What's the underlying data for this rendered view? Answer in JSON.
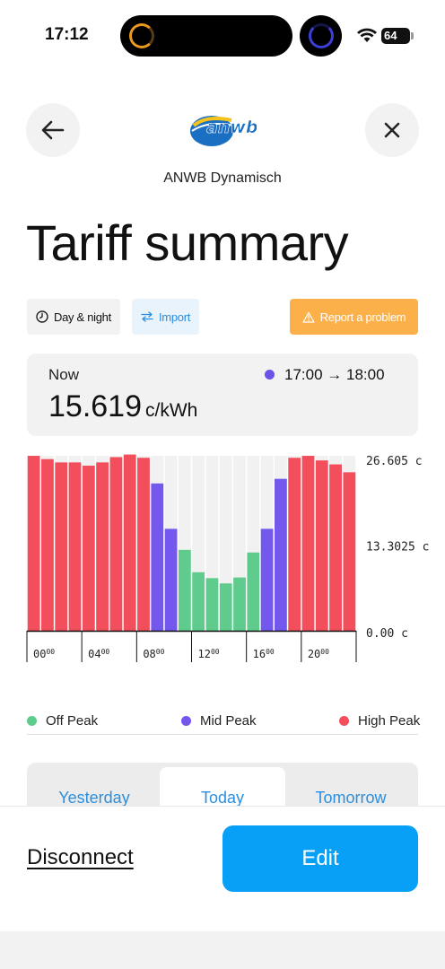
{
  "status_bar": {
    "time": "17:12",
    "battery": "64"
  },
  "header": {
    "provider_name": "ANWB Dynamisch",
    "logo_text": "anwb"
  },
  "page_title": "Tariff summary",
  "chips": {
    "day_night": "Day & night",
    "import": "Import",
    "report": "Report a problem"
  },
  "now": {
    "label": "Now",
    "value": "15.619",
    "unit": "c/kWh",
    "range": "17:00 → 18:00",
    "dot_color": "#6b52e8"
  },
  "colors": {
    "off_peak": "#5fcb8c",
    "mid_peak": "#7458ee",
    "high_peak": "#f24e5c",
    "accent": "#08a0f7",
    "report": "#fbb04a"
  },
  "chart_data": {
    "type": "bar",
    "categories": [
      "00",
      "01",
      "02",
      "03",
      "04",
      "05",
      "06",
      "07",
      "08",
      "09",
      "10",
      "11",
      "12",
      "13",
      "14",
      "15",
      "16",
      "17",
      "18",
      "19",
      "20",
      "21",
      "22",
      "23"
    ],
    "values": [
      26.6,
      26.1,
      25.6,
      25.6,
      25.1,
      25.6,
      26.4,
      26.8,
      26.3,
      22.4,
      15.5,
      12.3,
      8.9,
      8.0,
      7.2,
      8.1,
      11.9,
      15.5,
      23.1,
      26.3,
      26.6,
      25.9,
      25.3,
      24.1
    ],
    "levels": [
      "high",
      "high",
      "high",
      "high",
      "high",
      "high",
      "high",
      "high",
      "high",
      "mid",
      "mid",
      "off",
      "off",
      "off",
      "off",
      "off",
      "off",
      "mid",
      "mid",
      "high",
      "high",
      "high",
      "high",
      "high"
    ],
    "ylim": [
      0,
      26.605
    ],
    "ytick_labels": [
      "26.605 c",
      "13.3025 c",
      "0.00 c"
    ],
    "xtick_labels": [
      {
        "hour": "00",
        "minutes": "00"
      },
      {
        "hour": "04",
        "minutes": "00"
      },
      {
        "hour": "08",
        "minutes": "00"
      },
      {
        "hour": "12",
        "minutes": "00"
      },
      {
        "hour": "16",
        "minutes": "00"
      },
      {
        "hour": "20",
        "minutes": "00"
      }
    ],
    "legend": [
      "Off Peak",
      "Mid Peak",
      "High Peak"
    ]
  },
  "legend": {
    "off_peak": "Off Peak",
    "mid_peak": "Mid Peak",
    "high_peak": "High Peak"
  },
  "day_tabs": {
    "yesterday": "Yesterday",
    "today": "Today",
    "tomorrow": "Tomorrow",
    "selected": "Today"
  },
  "actions": {
    "disconnect": "Disconnect",
    "edit": "Edit"
  }
}
